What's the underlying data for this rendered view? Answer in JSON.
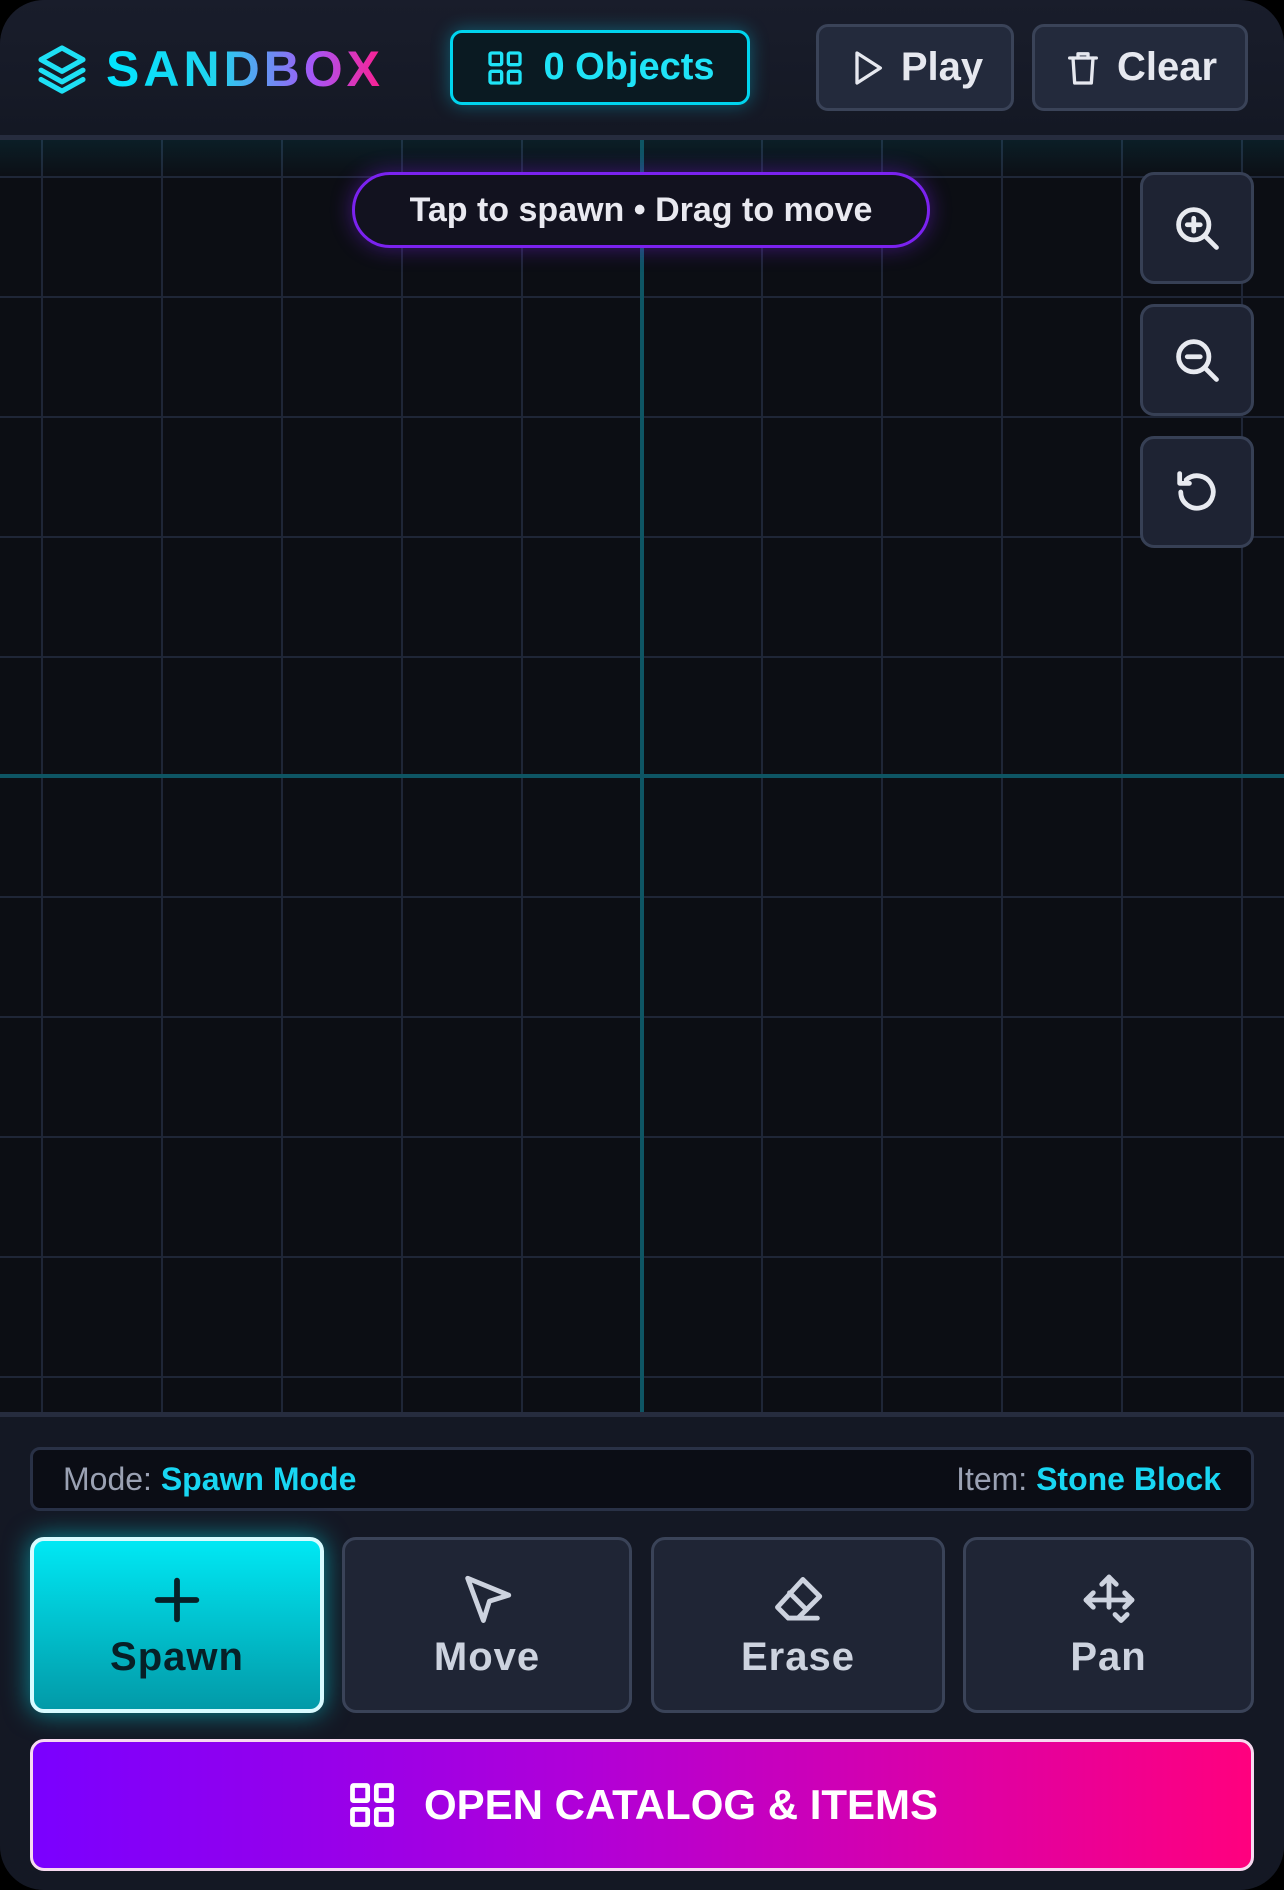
{
  "header": {
    "logo_text": "SANDBOX",
    "objects_label": "0 Objects",
    "play_label": "Play",
    "clear_label": "Clear"
  },
  "canvas": {
    "hint": "Tap to spawn • Drag to move",
    "controls": [
      "zoom-in-icon",
      "zoom-out-icon",
      "reset-view-icon"
    ]
  },
  "status": {
    "mode_label": "Mode:",
    "mode_value": "Spawn Mode",
    "item_label": "Item:",
    "item_value": "Stone Block"
  },
  "tools": [
    {
      "label": "Spawn",
      "icon": "plus-icon",
      "active": true
    },
    {
      "label": "Move",
      "icon": "cursor-icon",
      "active": false
    },
    {
      "label": "Erase",
      "icon": "eraser-icon",
      "active": false
    },
    {
      "label": "Pan",
      "icon": "move-arrows-icon",
      "active": false
    }
  ],
  "catalog_button": "OPEN CATALOG & ITEMS",
  "colors": {
    "accent_cyan": "#00e5ff",
    "accent_purple": "#7a00ff",
    "accent_pink": "#ff007e",
    "background": "#0c0e14"
  }
}
